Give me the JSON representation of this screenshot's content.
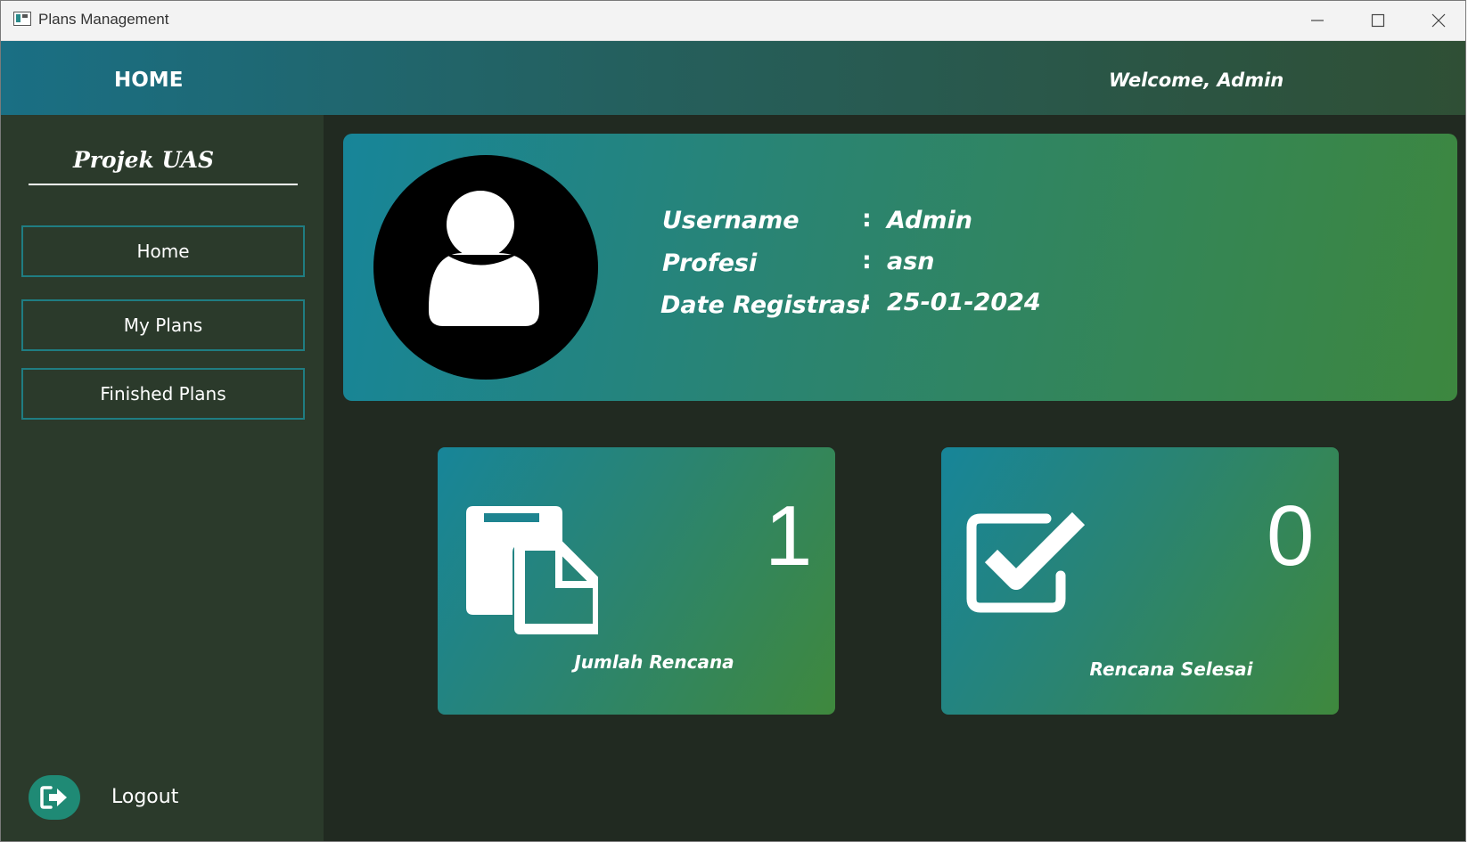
{
  "window": {
    "title": "Plans Management",
    "controls": [
      "minimize-icon",
      "maximize-icon",
      "close-icon"
    ]
  },
  "header": {
    "title": "HOME",
    "welcome": "Welcome,  Admin"
  },
  "sidebar": {
    "brand": "Projek UAS",
    "items": [
      {
        "label": "Home"
      },
      {
        "label": "My Plans"
      },
      {
        "label": "Finished Plans"
      }
    ],
    "logout_label": "Logout",
    "logout_icon": "logout-icon"
  },
  "profile": {
    "avatar_icon": "user-icon",
    "username_label": "Username",
    "username_value": "Admin",
    "profesi_label": "Profesi",
    "profesi_value": "asn",
    "date_label": "Date Registrasi",
    "date_value": "25-01-2024",
    "separator": ":"
  },
  "stats": [
    {
      "icon": "documents-icon",
      "value": "1",
      "label": "Jumlah Rencana"
    },
    {
      "icon": "checkbox-icon",
      "value": "0",
      "label": "Rencana Selesai"
    }
  ],
  "colors": {
    "header_gradient": [
      "#1a6f84",
      "#2f4f35"
    ],
    "sidebar_bg": "#2b3a2b",
    "main_bg": "#212a21",
    "card_gradient": [
      "#178599",
      "#3d873f"
    ],
    "nav_border": "#1f7d82"
  }
}
